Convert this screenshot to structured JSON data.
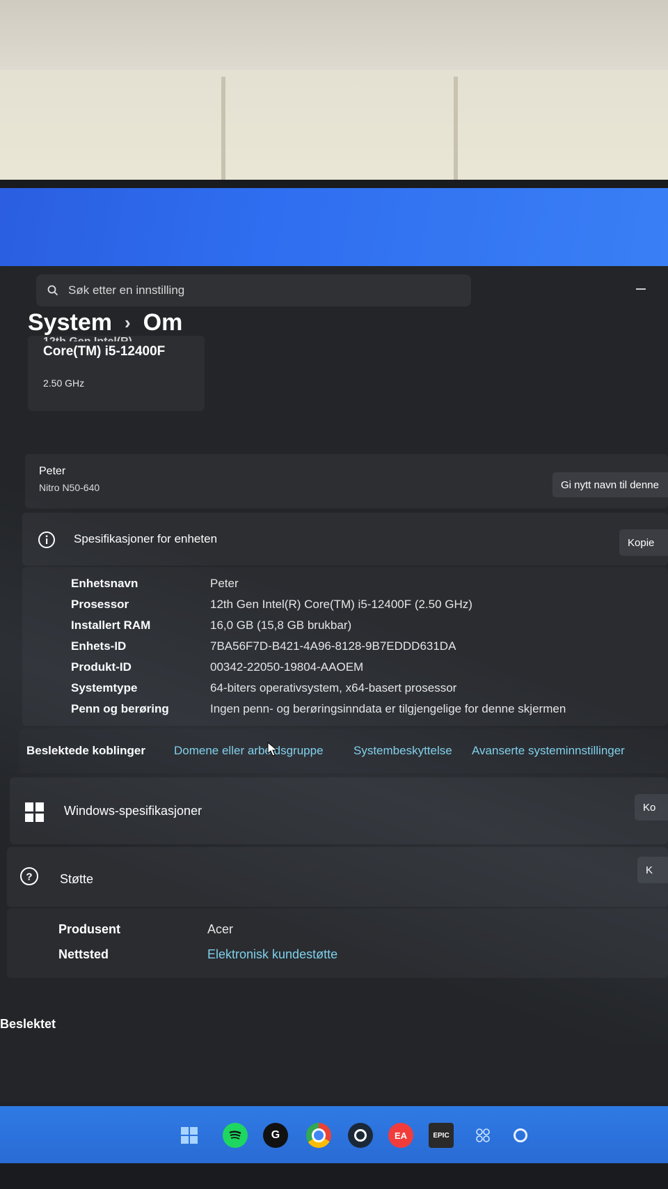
{
  "search": {
    "placeholder": "Søk etter en innstilling"
  },
  "breadcrumb": {
    "parent": "System",
    "current": "Om"
  },
  "cpu_card": {
    "name": "Core(TM) i5-12400F",
    "frequency": "2.50 GHz",
    "cut_line": "12th Gen Intel(R)"
  },
  "device": {
    "name": "Peter",
    "model": "Nitro N50-640",
    "rename_button": "Gi nytt navn til denne"
  },
  "specs": {
    "title": "Spesifikasjoner for enheten",
    "copy_button": "Kopie",
    "rows": [
      {
        "key": "Enhetsnavn",
        "value": "Peter"
      },
      {
        "key": "Prosessor",
        "value": "12th Gen Intel(R) Core(TM) i5-12400F (2.50 GHz)"
      },
      {
        "key": "Installert RAM",
        "value": "16,0 GB (15,8 GB brukbar)"
      },
      {
        "key": "Enhets-ID",
        "value": "7BA56F7D-B421-4A96-8128-9B7EDDD631DA"
      },
      {
        "key": "Produkt-ID",
        "value": "00342-22050-19804-AAOEM"
      },
      {
        "key": "Systemtype",
        "value": "64-biters operativsystem, x64-basert prosessor"
      },
      {
        "key": "Penn og berøring",
        "value": "Ingen penn- og berøringsinndata er tilgjengelige for denne skjermen"
      }
    ]
  },
  "related": {
    "label": "Beslektede koblinger",
    "links": [
      "Domene eller arbeidsgruppe",
      "Systembeskyttelse",
      "Avanserte systeminnstillinger"
    ]
  },
  "windows_spec": {
    "title": "Windows-spesifikasjoner",
    "copy_button": "Ko"
  },
  "support": {
    "title": "Støtte",
    "copy_button": "K",
    "rows": [
      {
        "key": "Produsent",
        "value": "Acer"
      },
      {
        "key": "Nettsted",
        "value": "Elektronisk kundestøtte"
      }
    ]
  },
  "beslektet": "Beslektet",
  "taskbar": {
    "icons": [
      "windows-start-icon",
      "spotify-icon",
      "g-hub-icon",
      "chrome-icon",
      "steam-icon",
      "ea-icon",
      "epic-games-icon",
      "widgets-icon",
      "settings-icon"
    ],
    "colors": {
      "spotify": "#1ed760",
      "chrome": "#ea4335",
      "ea": "#f23c3c",
      "steam": "#1b2838"
    },
    "epic_label": "EPIC",
    "ea_label": "EA"
  }
}
